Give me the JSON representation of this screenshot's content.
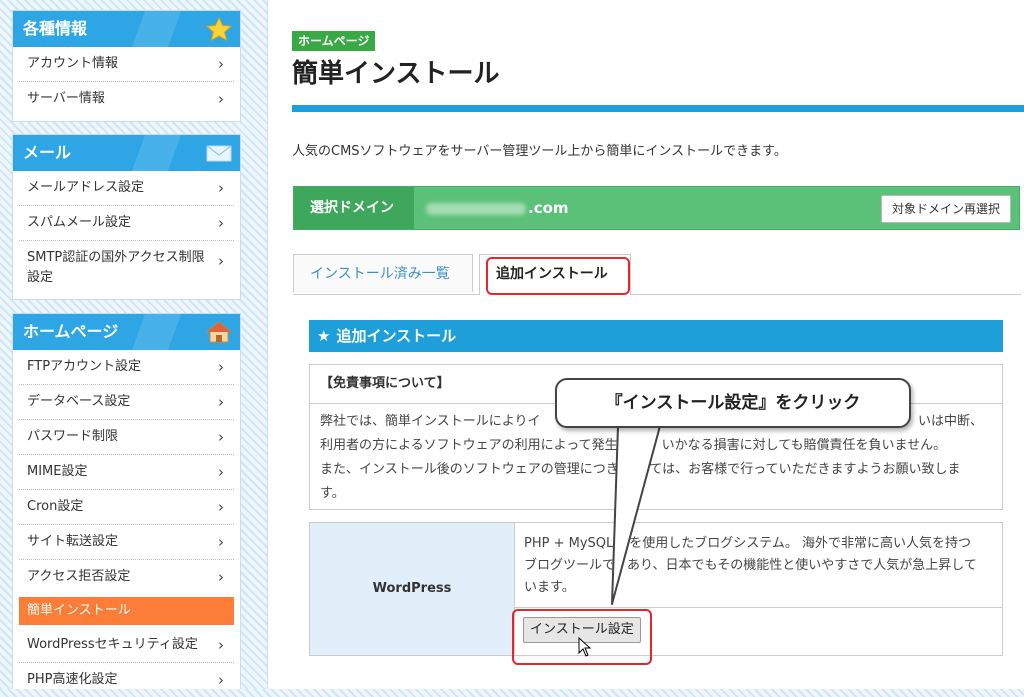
{
  "sidebar": {
    "sections": [
      {
        "title": "各種情報",
        "icon": "star-icon",
        "items": [
          {
            "label": "アカウント情報"
          },
          {
            "label": "サーバー情報"
          }
        ]
      },
      {
        "title": "メール",
        "icon": "mail-icon",
        "items": [
          {
            "label": "メールアドレス設定"
          },
          {
            "label": "スパムメール設定"
          },
          {
            "label": "SMTP認証の国外アクセス制限設定"
          }
        ]
      },
      {
        "title": "ホームページ",
        "icon": "house-icon",
        "items": [
          {
            "label": "FTPアカウント設定"
          },
          {
            "label": "データベース設定"
          },
          {
            "label": "パスワード制限"
          },
          {
            "label": "MIME設定"
          },
          {
            "label": "Cron設定"
          },
          {
            "label": "サイト転送設定"
          },
          {
            "label": "アクセス拒否設定"
          },
          {
            "label": "簡単インストール",
            "active": true
          },
          {
            "label": "WordPressセキュリティ設定"
          },
          {
            "label": "PHP高速化設定"
          }
        ]
      }
    ]
  },
  "main": {
    "category_badge": "ホームページ",
    "title": "簡単インストール",
    "intro": "人気のCMSソフトウェアをサーバー管理ツール上から簡単にインストールできます。",
    "domain": {
      "label": "選択ドメイン",
      "value_suffix": ".com",
      "reselect_button": "対象ドメイン再選択"
    },
    "tabs": [
      {
        "label": "インストール済み一覧",
        "active": false
      },
      {
        "label": "追加インストール",
        "active": true
      }
    ],
    "section_title": "追加インストール",
    "disclaimer": {
      "title": "【免責事項について】",
      "line1": "弊社では、簡単インストールによりイ",
      "line1_end": "いは中断、",
      "line2": "利用者の方によるソフトウェアの利用によって発生し",
      "line2_end": "、いかなる損害に対しても賠償責任を負いません。",
      "line3": "また、インストール後のソフトウェアの管理につき",
      "line3_end": "しては、お客様で行っていただきますようお願い致しま",
      "line4": "す。"
    },
    "software": {
      "name": "WordPress",
      "desc_line1": "PHP + MySQL",
      "desc_line1_end": "を使用したブログシステム。 海外で非常に高い人気を持つ",
      "desc_line2": "ブログツールで",
      "desc_line2_end": "あり、日本でもその機能性と使いやすさで人気が急上昇して",
      "desc_line3": "います。",
      "install_button": "インストール設定"
    }
  },
  "annotation": {
    "callout_text": "『インストール設定』をクリック",
    "highlight_color": "#e5262f"
  },
  "colors": {
    "sidebar_header": "#2ea6e6",
    "active_item": "#fb7d37",
    "domain_bar": "#5bc178",
    "badge": "#39a946",
    "accent_blue": "#1e9fd9"
  }
}
